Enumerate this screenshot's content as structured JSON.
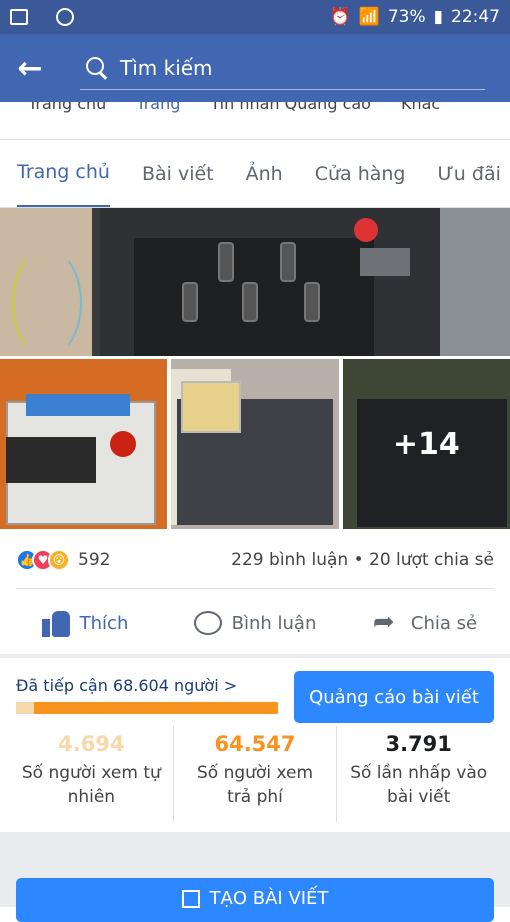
{
  "status_bar": {
    "battery": "73%",
    "time": "22:47"
  },
  "search": {
    "placeholder": "Tìm kiếm"
  },
  "subnav": {
    "items": [
      "Trang chủ",
      "Trang",
      "Tin nhắn Quảng cáo",
      "Khác"
    ]
  },
  "tabs": [
    "Trang chủ",
    "Bài viết",
    "Ảnh",
    "Cửa hàng",
    "Ưu đãi"
  ],
  "photos": {
    "more_count": "+14"
  },
  "reactions": {
    "count": "592",
    "meta": "229 bình luận • 20 lượt chia sẻ",
    "icons": [
      "like-icon",
      "love-icon",
      "wow-icon"
    ]
  },
  "actions": {
    "like": "Thích",
    "comment": "Bình luận",
    "share": "Chia sẻ"
  },
  "reach": {
    "label": "Đã tiếp cận 68.604 người",
    "chevron": ">",
    "organic_fraction": 0.068,
    "boost_button": "Quảng cáo bài viết",
    "stats": [
      {
        "value": "4.694",
        "label_line1": "Số người xem tự",
        "label_line2": "nhiên",
        "color": "#f5d9a8"
      },
      {
        "value": "64.547",
        "label_line1": "Số người xem",
        "label_line2": "trả phí",
        "color": "#f7931e"
      },
      {
        "value": "3.791",
        "label_line1": "Số lần nhấp vào",
        "label_line2": "bài viết",
        "color": "#1c1e21"
      }
    ]
  },
  "create_post": "TẠO BÀI VIẾT",
  "colors": {
    "header": "#4267b2",
    "accent": "#2d88ff",
    "orange": "#f7931e"
  }
}
